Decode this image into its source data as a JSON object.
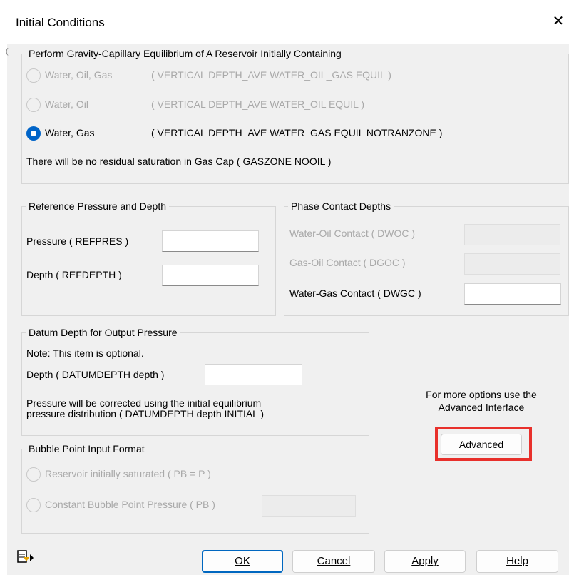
{
  "window": {
    "title": "Initial Conditions",
    "close_glyph": "✕"
  },
  "equilibrium": {
    "legend": "Perform Gravity-Capillary Equilibrium of A Reservoir Initially Containing",
    "options": [
      {
        "label": "Water, Oil, Gas",
        "keyword": "( VERTICAL DEPTH_AVE WATER_OIL_GAS EQUIL )",
        "selected": false,
        "enabled": false
      },
      {
        "label": "Water, Oil",
        "keyword": "( VERTICAL DEPTH_AVE WATER_OIL EQUIL )",
        "selected": false,
        "enabled": false
      },
      {
        "label": "Water, Gas",
        "keyword": "( VERTICAL DEPTH_AVE WATER_GAS EQUIL NOTRANZONE )",
        "selected": true,
        "enabled": true
      }
    ],
    "note": "There will be no residual saturation in Gas Cap ( GASZONE NOOIL )"
  },
  "reference": {
    "legend": "Reference Pressure and Depth",
    "pressure_label": "Pressure ( REFPRES )",
    "pressure_value": "",
    "depth_label": "Depth ( REFDEPTH )",
    "depth_value": ""
  },
  "contacts": {
    "legend": "Phase Contact Depths",
    "dwoc_label": "Water-Oil Contact ( DWOC )",
    "dgoc_label": "Gas-Oil Contact ( DGOC )",
    "dwgc_label": "Water-Gas Contact ( DWGC )",
    "dwgc_value": ""
  },
  "datum": {
    "legend": "Datum Depth for Output Pressure",
    "note": "Note: This item is optional.",
    "depth_label": "Depth ( DATUMDEPTH depth )",
    "depth_value": "",
    "info_line1": "Pressure will be corrected using the initial equilibrium",
    "info_line2": "pressure distribution ( DATUMDEPTH depth INITIAL )"
  },
  "advanced": {
    "hint_line1": "For more options use the",
    "hint_line2": "Advanced Interface",
    "button_label": "Advanced",
    "highlight_color": "#e8302b"
  },
  "bubble": {
    "legend": "Bubble Point Input Format",
    "option1": "Reservoir initially saturated ( PB = P )",
    "option2": "Constant Bubble Point Pressure ( PB )"
  },
  "footer": {
    "ok_label": "OK",
    "cancel_label": "Cancel",
    "apply_label": "Apply",
    "help_label": "Help",
    "icon": "script-arrow-icon"
  },
  "colors": {
    "accent": "#0064c8",
    "disabled_text": "#a9a9a9"
  }
}
